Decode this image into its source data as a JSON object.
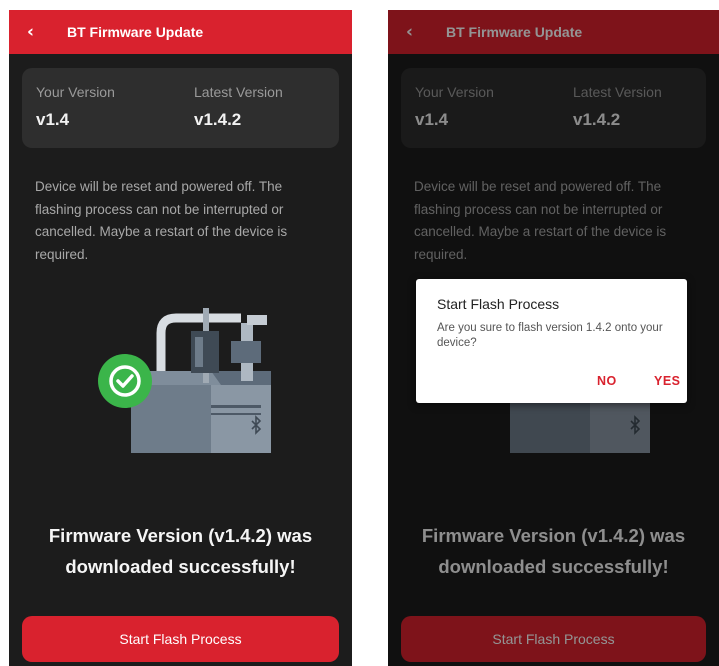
{
  "screens": [
    {
      "header": {
        "back_icon": "chevron-left-icon",
        "title": "BT Firmware Update"
      },
      "versions": {
        "yours_label": "Your Version",
        "yours_value": "v1.4",
        "latest_label": "Latest Version",
        "latest_value": "v1.4.2"
      },
      "info_text": "Device will be reset and powered off. The flashing process can not be interrupted or cancelled. Maybe a restart of the device is required.",
      "illustration_icons": [
        "device-illustration",
        "check-circle-icon",
        "bluetooth-icon"
      ],
      "success_line1": "Firmware Version (v1.4.2) was",
      "success_line2": "downloaded successfully!",
      "button_label": "Start Flash Process"
    },
    {
      "header": {
        "back_icon": "chevron-left-icon",
        "title": "BT Firmware Update"
      },
      "versions": {
        "yours_label": "Your Version",
        "yours_value": "v1.4",
        "latest_label": "Latest Version",
        "latest_value": "v1.4.2"
      },
      "info_text": "Device will be reset and powered off. The flashing process can not be interrupted or cancelled. Maybe a restart of the device is required.",
      "illustration_icons": [
        "device-illustration",
        "bluetooth-icon"
      ],
      "success_line1": "Firmware Version (v1.4.2) was",
      "success_line2": "downloaded successfully!",
      "button_label": "Start Flash Process",
      "dialog": {
        "title": "Start Flash Process",
        "message": "Are you sure to flash version 1.4.2 onto your device?",
        "no_label": "NO",
        "yes_label": "YES"
      }
    }
  ],
  "colors": {
    "accent": "#d9222e",
    "background": "#1c1c1c",
    "card": "#2e2e2e",
    "success": "#3bb54a"
  }
}
